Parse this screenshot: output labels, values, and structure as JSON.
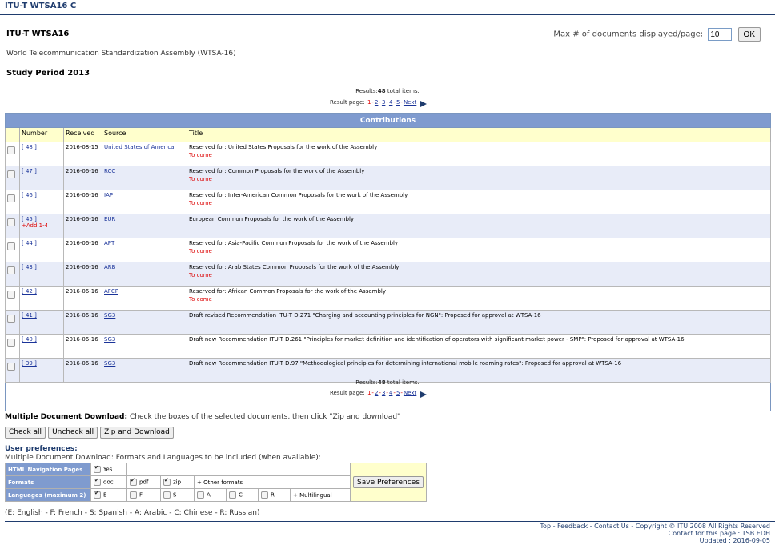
{
  "topbar": {
    "title": "ITU-T WTSA16  C"
  },
  "header": {
    "title": "ITU-T WTSA16",
    "subtitle": "World Telecommunication Standardization Assembly (WTSA-16)",
    "period": "Study Period 2013",
    "maxdocs_label": "Max # of documents displayed/page:",
    "maxdocs_value": "10",
    "ok_label": "OK"
  },
  "results": {
    "label": "Results:",
    "count": "48",
    "suffix": "total items.",
    "page_label": "Result page:",
    "pages": [
      "1",
      "2",
      "3",
      "4",
      "5"
    ],
    "next": "Next"
  },
  "table": {
    "caption": "Contributions",
    "columns": [
      "Number",
      "Received",
      "Source",
      "Title"
    ],
    "rows": [
      {
        "number": "[ 48 ]",
        "received": "2016-08-15",
        "source": "United States of America",
        "title": "Reserved for: United States Proposals for the work of the Assembly",
        "note": "To come",
        "add": ""
      },
      {
        "number": "[ 47 ]",
        "received": "2016-06-16",
        "source": "RCC",
        "title": "Reserved for: Common Proposals for the work of the Assembly",
        "note": "To come",
        "add": ""
      },
      {
        "number": "[ 46 ]",
        "received": "2016-06-16",
        "source": "IAP",
        "title": "Reserved for: Inter-American Common Proposals for the work of the Assembly",
        "note": "To come",
        "add": ""
      },
      {
        "number": "[ 45 ]",
        "received": "2016-06-16",
        "source": "EUR",
        "title": "European Common Proposals for the work of the Assembly",
        "note": "",
        "add": "+Add.1-4"
      },
      {
        "number": "[ 44 ]",
        "received": "2016-06-16",
        "source": "APT",
        "title": "Reserved for: Asia-Pacific Common Proposals for the work of the Assembly",
        "note": "To come",
        "add": ""
      },
      {
        "number": "[ 43 ]",
        "received": "2016-06-16",
        "source": "ARB",
        "title": "Reserved for: Arab States Common Proposals for the work of the Assembly",
        "note": "To come",
        "add": ""
      },
      {
        "number": "[ 42 ]",
        "received": "2016-06-16",
        "source": "AFCP",
        "title": "Reserved for: African Common Proposals for the work of the Assembly",
        "note": "To come",
        "add": ""
      },
      {
        "number": "[ 41 ]",
        "received": "2016-06-16",
        "source": "SG3",
        "title": "Draft revised Recommendation ITU-T D.271 \"Charging and accounting principles for NGN\": Proposed for approval at WTSA-16",
        "note": "",
        "add": ""
      },
      {
        "number": "[ 40 ]",
        "received": "2016-06-16",
        "source": "SG3",
        "title": "Draft new Recommendation ITU-T D.261 \"Principles for market definition and identification of operators with significant market power - SMP\": Proposed for approval at WTSA-16",
        "note": "",
        "add": ""
      },
      {
        "number": "[ 39 ]",
        "received": "2016-06-16",
        "source": "SG3",
        "title": "Draft new Recommendation ITU-T D.97 \"Methodological principles for determining international mobile roaming rates\": Proposed for approval at WTSA-16",
        "note": "",
        "add": ""
      }
    ]
  },
  "mdd": {
    "label": "Multiple Document Download:",
    "text": "Check the boxes of the selected documents, then click \"Zip and download\"",
    "check_all": "Check all",
    "uncheck_all": "Uncheck all",
    "zip": "Zip and Download"
  },
  "prefs": {
    "title": "User preferences:",
    "subtitle": "Multiple Document Download: Formats and Languages to be included (when available):",
    "nav_label": "HTML Navigation Pages",
    "nav_yes": "Yes",
    "formats_label": "Formats",
    "fmt_doc": "doc",
    "fmt_pdf": "pdf",
    "fmt_zip": "zip",
    "fmt_other": "+ Other formats",
    "lang_label": "Languages (maximum 2)",
    "lang_e": "E",
    "lang_f": "F",
    "lang_s": "S",
    "lang_a": "A",
    "lang_c": "C",
    "lang_r": "R",
    "lang_multi": "+ Multilingual",
    "save": "Save Preferences",
    "legend": "(E: English - F: French - S: Spanish - A: Arabic - C: Chinese - R: Russian)"
  },
  "footer": {
    "top": "Top",
    "feedback": "Feedback",
    "contact": "Contact Us",
    "copyright": "Copyright © ITU 2008 All Rights Reserved",
    "contact_page": "Contact for this page : TSB EDH",
    "updated": "Updated : 2016-09-05"
  }
}
